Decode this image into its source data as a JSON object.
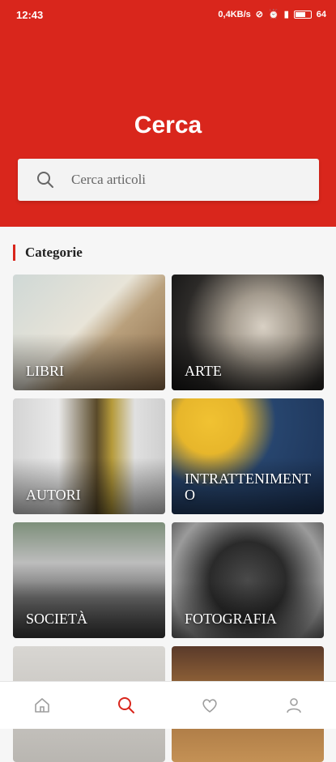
{
  "status_bar": {
    "time": "12:43",
    "network": "0,4KB/s",
    "battery": "64"
  },
  "header": {
    "title": "Cerca"
  },
  "search": {
    "placeholder": "Cerca articoli"
  },
  "section": {
    "title": "Categorie"
  },
  "categories": [
    {
      "label": "LIBRI"
    },
    {
      "label": "ARTE"
    },
    {
      "label": "AUTORI"
    },
    {
      "label": "INTRATTENIMENTO"
    },
    {
      "label": "SOCIETÀ"
    },
    {
      "label": "FOTOGRAFIA"
    },
    {
      "label": ""
    },
    {
      "label": ""
    }
  ],
  "bottom_nav": [
    {
      "icon": "home-icon"
    },
    {
      "icon": "search-icon",
      "active": true
    },
    {
      "icon": "heart-icon"
    },
    {
      "icon": "user-icon"
    }
  ],
  "colors": {
    "accent": "#d9261c",
    "inactive": "#9e9e9e"
  }
}
